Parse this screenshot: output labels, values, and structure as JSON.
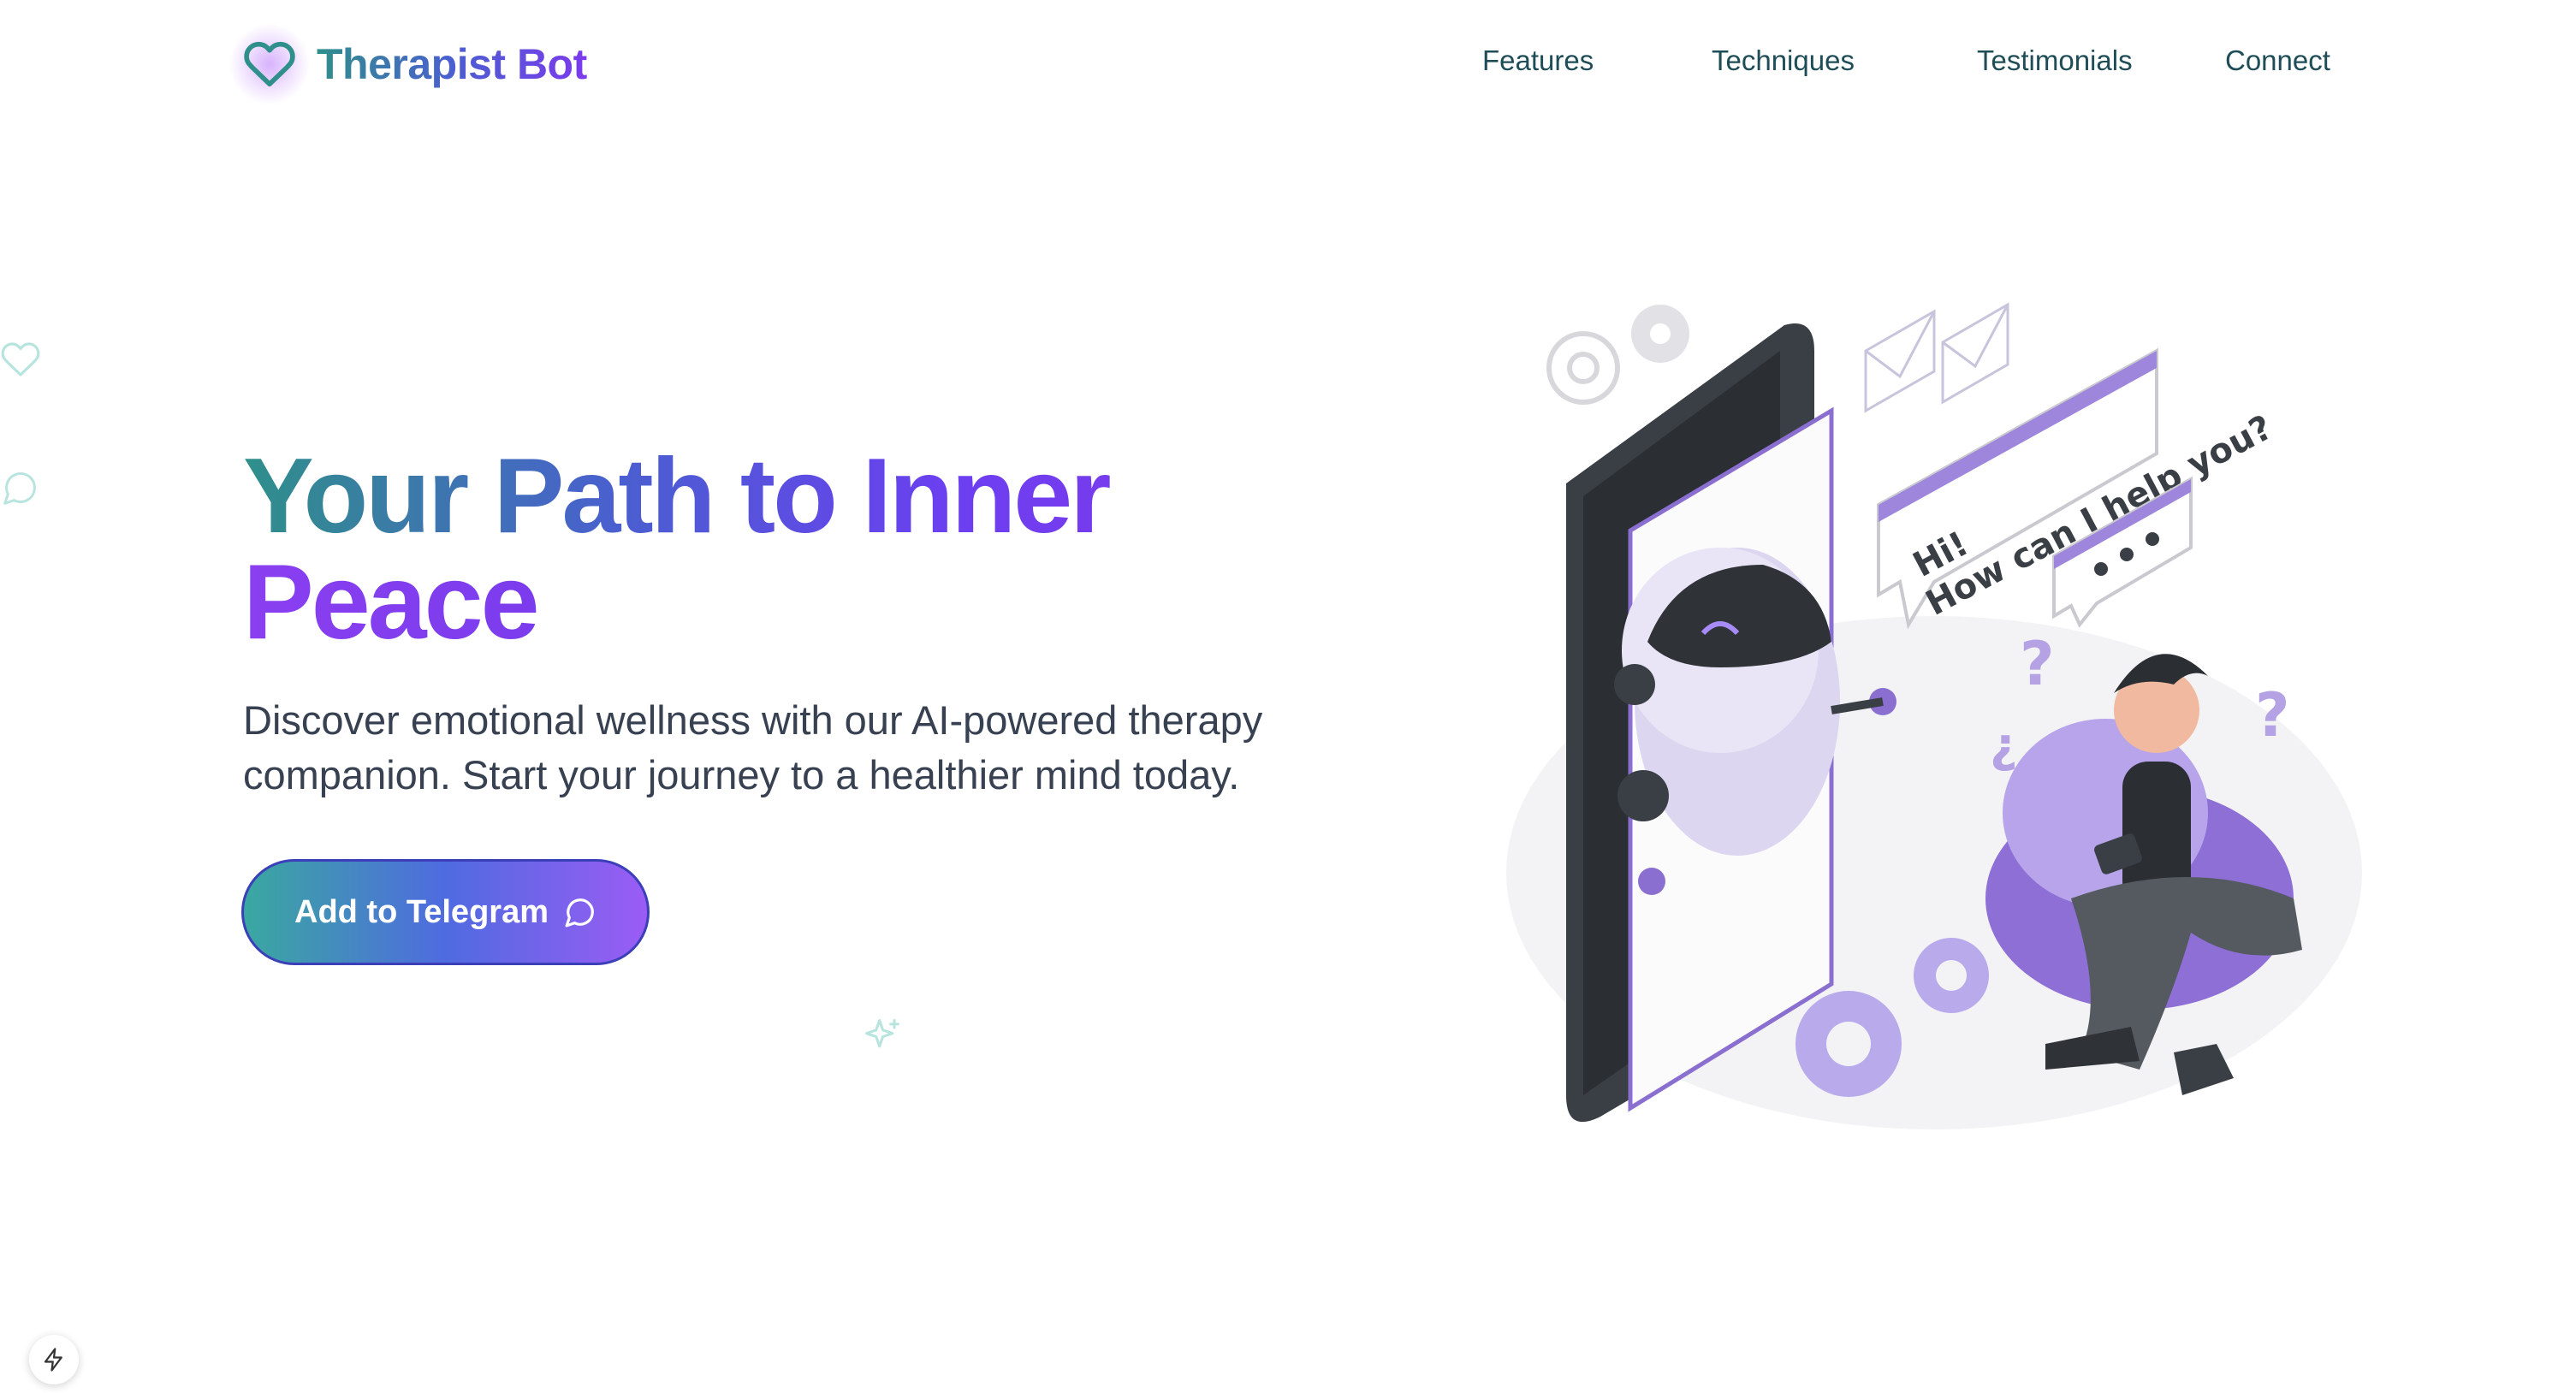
{
  "nav": {
    "brand": "Therapist Bot",
    "links": [
      "Features",
      "Techniques",
      "Testimonials",
      "Connect"
    ]
  },
  "hero": {
    "title_line1": "Your Path to Inner",
    "title_line2": "Peace",
    "subtitle": "Discover emotional wellness with our AI-powered therapy companion. Start your journey to a healthier mind today.",
    "cta_label": "Add to Telegram"
  },
  "illustration": {
    "bubble_line1": "Hi!",
    "bubble_line2": "How can I help you?"
  },
  "colors": {
    "teal": "#2f8f8a",
    "indigo": "#4a5fd0",
    "purple": "#7c3aed",
    "nav_text": "#1f4d57",
    "lavender": "#a78bfa"
  },
  "icons": [
    "heart-icon",
    "chat-icon",
    "sparkle-icon",
    "bolt-icon"
  ]
}
